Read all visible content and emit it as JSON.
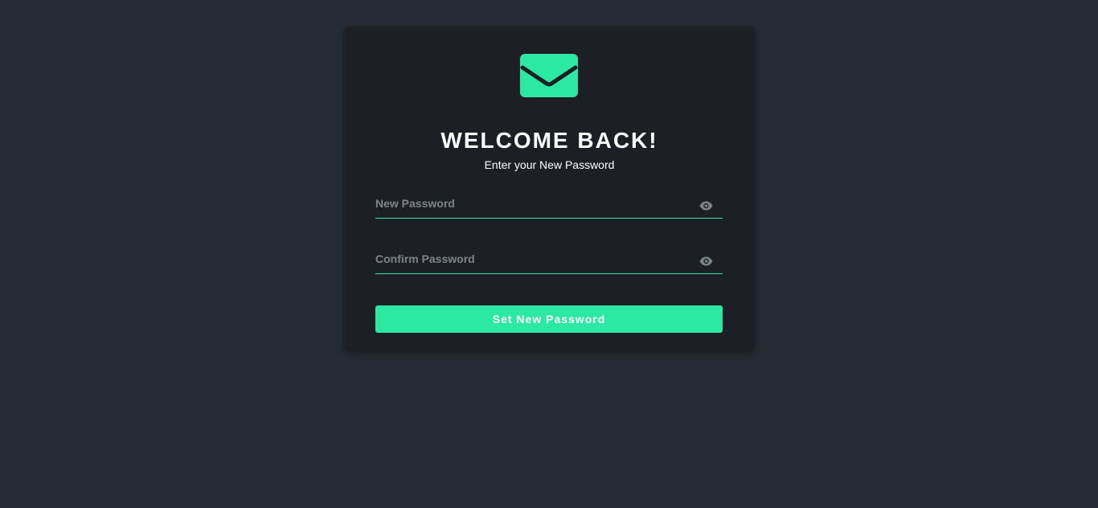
{
  "colors": {
    "background": "#232c32",
    "card": "#1c2024",
    "accent": "#2be8a3",
    "placeholder": "#7d858a",
    "text": "#ffffff"
  },
  "card": {
    "logo_icon": "envelope-icon",
    "title": "WELCOME BACK!",
    "subtitle": "Enter your New Password"
  },
  "form": {
    "new_password": {
      "placeholder": "New Password",
      "value": "",
      "toggle_icon": "eye-icon"
    },
    "confirm_password": {
      "placeholder": "Confirm Password",
      "value": "",
      "toggle_icon": "eye-icon"
    },
    "submit_label": "Set New Password"
  }
}
